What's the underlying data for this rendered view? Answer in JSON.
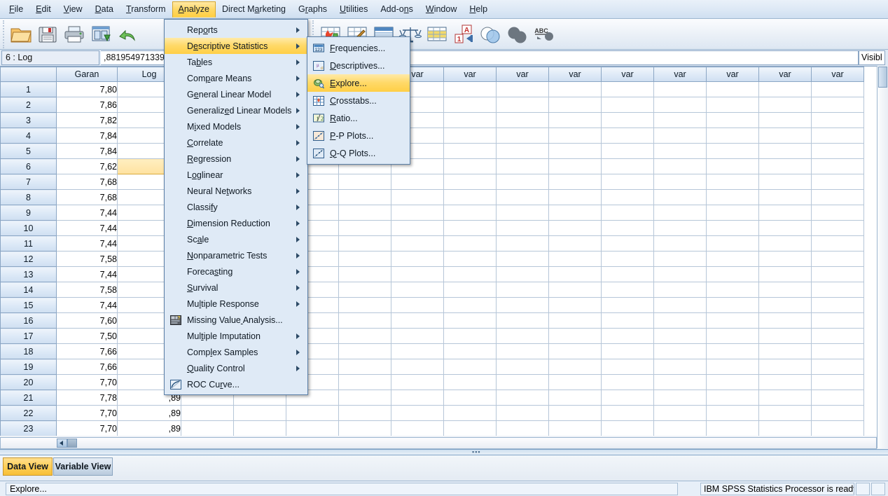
{
  "menubar": {
    "items": [
      {
        "label": "File",
        "accel": 0
      },
      {
        "label": "Edit",
        "accel": 0
      },
      {
        "label": "View",
        "accel": 0
      },
      {
        "label": "Data",
        "accel": 0
      },
      {
        "label": "Transform",
        "accel": 0
      },
      {
        "label": "Analyze",
        "accel": 0
      },
      {
        "label": "Direct Marketing",
        "accel": 8
      },
      {
        "label": "Graphs",
        "accel": 1
      },
      {
        "label": "Utilities",
        "accel": 0
      },
      {
        "label": "Add-ons",
        "accel": 5
      },
      {
        "label": "Window",
        "accel": 0
      },
      {
        "label": "Help",
        "accel": 0
      }
    ],
    "active_index": 5
  },
  "toolbar": {
    "buttons": [
      {
        "name": "open-file-icon",
        "title": "Open data document"
      },
      {
        "name": "save-icon",
        "title": "Save this document"
      },
      {
        "name": "print-icon",
        "title": "Print"
      },
      {
        "name": "recall-dialogs-icon",
        "title": "Recall recently used dialogs"
      },
      {
        "name": "undo-icon",
        "title": "Undo a user action"
      },
      {
        "name": "goto-case-icon",
        "title": "Go to case"
      },
      {
        "name": "goto-variable-icon",
        "title": "Go to variable"
      },
      {
        "name": "variables-icon",
        "title": "Variables"
      },
      {
        "name": "weight-cases-icon",
        "title": "Weight cases"
      },
      {
        "name": "split-file-icon",
        "title": "Split file"
      },
      {
        "name": "value-labels-icon",
        "title": "Value labels"
      },
      {
        "name": "select-cases-icon",
        "title": "Select cases"
      },
      {
        "name": "find-icon",
        "title": "Find"
      },
      {
        "name": "spellcheck-icon",
        "title": "Spell check"
      }
    ]
  },
  "cellbar": {
    "cell_reference": "6 : Log",
    "cell_value": ",881954971339",
    "visible_label": "Visibl"
  },
  "grid": {
    "columns": [
      "Garan",
      "Log"
    ],
    "var_column_label": "var",
    "var_column_count": 13,
    "rows": [
      {
        "n": "1",
        "garan": "7,80",
        "log": ""
      },
      {
        "n": "2",
        "garan": "7,86",
        "log": ""
      },
      {
        "n": "3",
        "garan": "7,82",
        "log": ""
      },
      {
        "n": "4",
        "garan": "7,84",
        "log": ""
      },
      {
        "n": "5",
        "garan": "7,84",
        "log": ""
      },
      {
        "n": "6",
        "garan": "7,62",
        "log": "",
        "selected": true
      },
      {
        "n": "7",
        "garan": "7,68",
        "log": ""
      },
      {
        "n": "8",
        "garan": "7,68",
        "log": ""
      },
      {
        "n": "9",
        "garan": "7,44",
        "log": ""
      },
      {
        "n": "10",
        "garan": "7,44",
        "log": ""
      },
      {
        "n": "11",
        "garan": "7,44",
        "log": ""
      },
      {
        "n": "12",
        "garan": "7,58",
        "log": ""
      },
      {
        "n": "13",
        "garan": "7,44",
        "log": ""
      },
      {
        "n": "14",
        "garan": "7,58",
        "log": ""
      },
      {
        "n": "15",
        "garan": "7,44",
        "log": ""
      },
      {
        "n": "16",
        "garan": "7,60",
        "log": ""
      },
      {
        "n": "17",
        "garan": "7,50",
        "log": ""
      },
      {
        "n": "18",
        "garan": "7,66",
        "log": ""
      },
      {
        "n": "19",
        "garan": "7,66",
        "log": ""
      },
      {
        "n": "20",
        "garan": "7,70",
        "log": ""
      },
      {
        "n": "21",
        "garan": "7,78",
        "log": ",89"
      },
      {
        "n": "22",
        "garan": "7,70",
        "log": ",89"
      },
      {
        "n": "23",
        "garan": "7,70",
        "log": ",89"
      }
    ]
  },
  "analyze_menu": {
    "items": [
      {
        "label": "Reports",
        "accel": 3,
        "submenu": true,
        "icon": null
      },
      {
        "label": "Descriptive Statistics",
        "accel": 1,
        "submenu": true,
        "icon": null,
        "highlighted": true
      },
      {
        "label": "Tables",
        "accel": 2,
        "submenu": true,
        "icon": null
      },
      {
        "label": "Compare Means",
        "accel": 3,
        "submenu": true,
        "icon": null
      },
      {
        "label": "General Linear Model",
        "accel": 1,
        "submenu": true,
        "icon": null
      },
      {
        "label": "Generalized Linear Models",
        "accel": 9,
        "submenu": true,
        "icon": null
      },
      {
        "label": "Mixed Models",
        "accel": 1,
        "submenu": true,
        "icon": null
      },
      {
        "label": "Correlate",
        "accel": 0,
        "submenu": true,
        "icon": null
      },
      {
        "label": "Regression",
        "accel": 0,
        "submenu": true,
        "icon": null
      },
      {
        "label": "Loglinear",
        "accel": 1,
        "submenu": true,
        "icon": null
      },
      {
        "label": "Neural Networks",
        "accel": 9,
        "submenu": true,
        "icon": null
      },
      {
        "label": "Classify",
        "accel": 6,
        "submenu": true,
        "icon": null
      },
      {
        "label": "Dimension Reduction",
        "accel": 0,
        "submenu": true,
        "icon": null
      },
      {
        "label": "Scale",
        "accel": 2,
        "submenu": true,
        "icon": null
      },
      {
        "label": "Nonparametric Tests",
        "accel": 0,
        "submenu": true,
        "icon": null
      },
      {
        "label": "Forecasting",
        "accel": 6,
        "submenu": true,
        "icon": null
      },
      {
        "label": "Survival",
        "accel": 0,
        "submenu": true,
        "icon": null
      },
      {
        "label": "Multiple Response",
        "accel": 2,
        "submenu": true,
        "icon": null
      },
      {
        "label": "Missing Value Analysis...",
        "accel": 13,
        "submenu": false,
        "icon": "missing-value-icon"
      },
      {
        "label": "Multiple Imputation",
        "accel": 3,
        "submenu": true,
        "icon": null
      },
      {
        "label": "Complex Samples",
        "accel": 4,
        "submenu": true,
        "icon": null
      },
      {
        "label": "Quality Control",
        "accel": 0,
        "submenu": true,
        "icon": null
      },
      {
        "label": "ROC Curve...",
        "accel": 6,
        "submenu": false,
        "icon": "roc-curve-icon"
      }
    ]
  },
  "descriptive_menu": {
    "items": [
      {
        "label": "Frequencies...",
        "accel": 0,
        "icon": "frequencies-icon"
      },
      {
        "label": "Descriptives...",
        "accel": 0,
        "icon": "descriptives-icon"
      },
      {
        "label": "Explore...",
        "accel": 0,
        "icon": "explore-icon",
        "highlighted": true
      },
      {
        "label": "Crosstabs...",
        "accel": 0,
        "icon": "crosstabs-icon"
      },
      {
        "label": "Ratio...",
        "accel": 0,
        "icon": "ratio-icon"
      },
      {
        "label": "P-P Plots...",
        "accel": 0,
        "icon": "pp-plots-icon"
      },
      {
        "label": "Q-Q Plots...",
        "accel": 0,
        "icon": "qq-plots-icon"
      }
    ]
  },
  "view_tabs": {
    "data_view": "Data View",
    "variable_view": "Variable View",
    "selected": "Data View"
  },
  "statusbar": {
    "left": "Explore...",
    "right": "IBM SPSS Statistics Processor is ready"
  },
  "colors": {
    "menu_highlight": "#ffd968",
    "menu_bg": "#dfeaf6",
    "header_blue": "#cfdff1",
    "selected_cell": "#ffe2a0",
    "tab_selected": "#ffcd53"
  }
}
